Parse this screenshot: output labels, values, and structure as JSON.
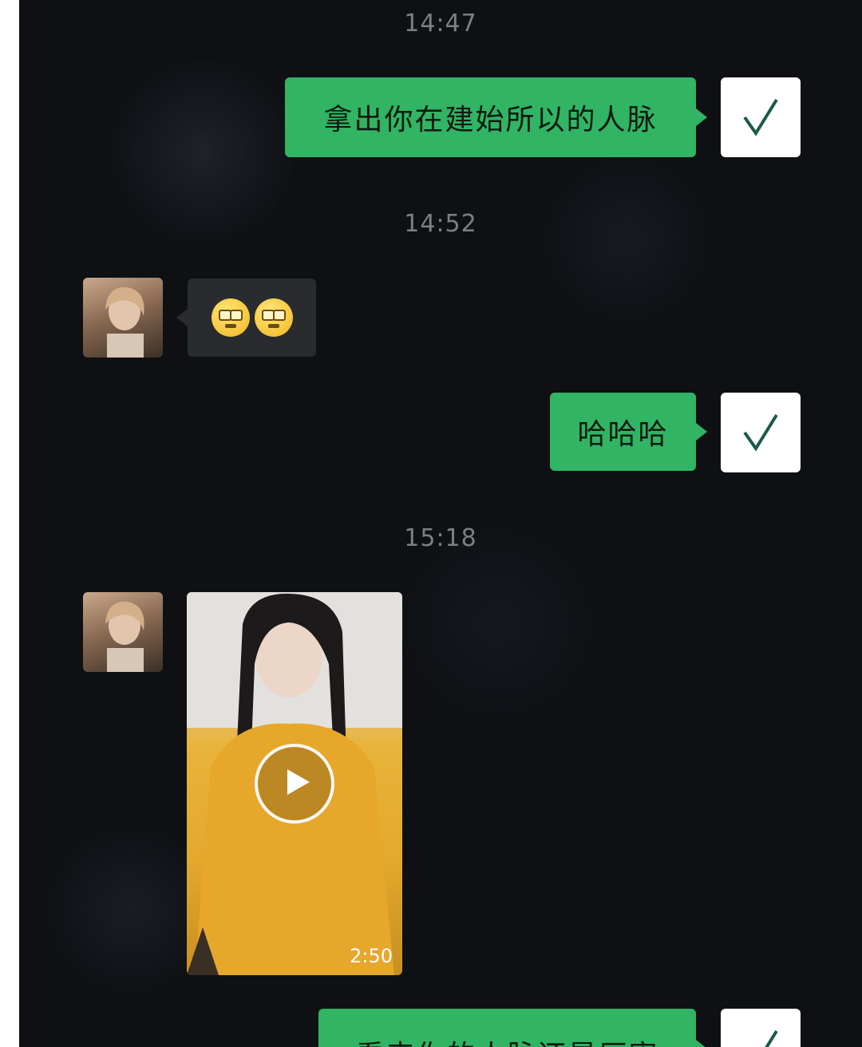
{
  "chat": {
    "timestamps": [
      "14:47",
      "14:52",
      "15:18"
    ],
    "messages": [
      {
        "side": "out",
        "text": "拿出你在建始所以的人脉"
      },
      {
        "side": "in",
        "emojis": [
          "face-emoji",
          "face-emoji"
        ]
      },
      {
        "side": "out",
        "text": "哈哈哈"
      },
      {
        "side": "in",
        "video_duration": "2:50"
      },
      {
        "side": "out",
        "text": "看来你的人脉还是厉害"
      }
    ],
    "self_avatar_glyph": "√"
  },
  "colors": {
    "background": "#0e1014",
    "outgoing_bubble": "#31b463",
    "incoming_bubble": "#2a2b2e",
    "timestamp": "#7d7f83"
  }
}
